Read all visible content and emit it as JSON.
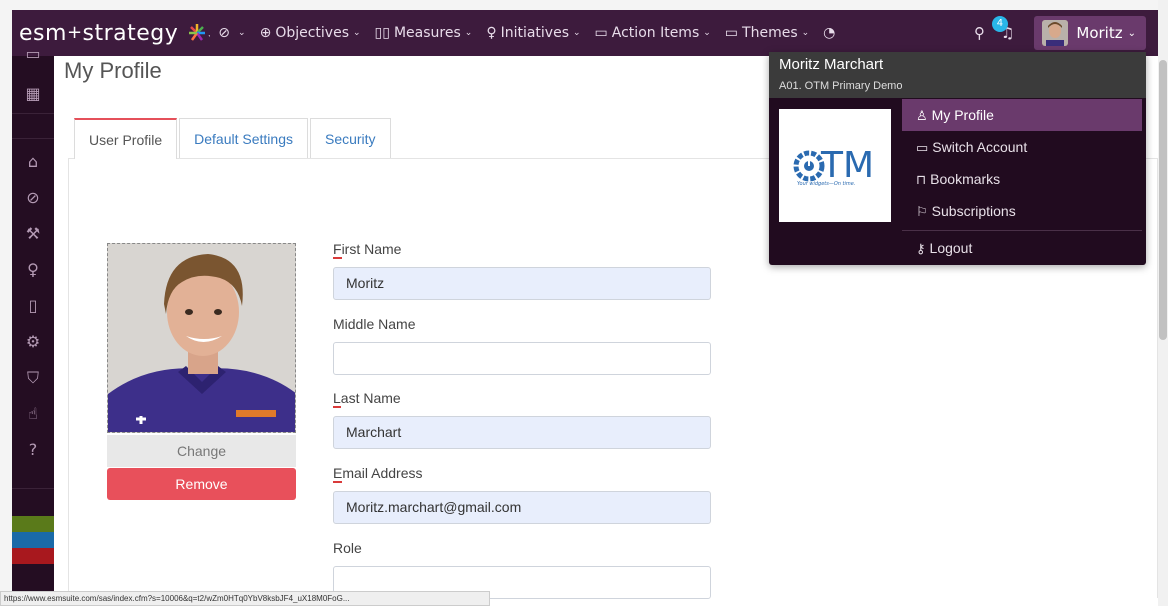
{
  "app": {
    "logo_text": "esm",
    "logo_plus": "+",
    "logo_text2": "strategy"
  },
  "nav": {
    "items": [
      {
        "icon": "compass-icon",
        "label": ""
      },
      {
        "icon": "crosshair-icon",
        "label": "Objectives"
      },
      {
        "icon": "bar-chart-icon",
        "label": "Measures"
      },
      {
        "icon": "lightbulb-icon",
        "label": "Initiatives"
      },
      {
        "icon": "inbox-icon",
        "label": "Action Items"
      },
      {
        "icon": "folder-icon",
        "label": "Themes"
      }
    ],
    "notification_count": "4",
    "user_label": "Moritz"
  },
  "page": {
    "title": "My Profile",
    "tabs": [
      {
        "label": "User Profile",
        "active": true
      },
      {
        "label": "Default Settings",
        "active": false
      },
      {
        "label": "Security",
        "active": false
      }
    ]
  },
  "photo": {
    "change_label": "Change",
    "remove_label": "Remove"
  },
  "form": {
    "first_name_label_first": "F",
    "first_name_label_rest": "irst Name",
    "first_name_value": "Moritz",
    "middle_name_label": "Middle Name",
    "middle_name_value": "",
    "last_name_label_first": "L",
    "last_name_label_rest": "ast Name",
    "last_name_value": "Marchart",
    "email_label_first": "E",
    "email_label_rest": "mail Address",
    "email_value": "Moritz.marchart@gmail.com",
    "role_label": "Role",
    "role_value": ""
  },
  "dropdown": {
    "user_name": "Moritz Marchart",
    "account": "A01. OTM Primary Demo",
    "logo_text": "TM",
    "logo_tagline": "Your widgets—On time.",
    "items": [
      {
        "icon": "user-icon",
        "label": "My Profile",
        "active": true
      },
      {
        "icon": "monitor-icon",
        "label": "Switch Account",
        "active": false
      },
      {
        "icon": "bookmark-icon",
        "label": "Bookmarks",
        "active": false
      },
      {
        "icon": "flag-icon",
        "label": "Subscriptions",
        "active": false
      },
      {
        "icon": "key-icon",
        "label": "Logout",
        "active": false
      }
    ]
  },
  "status_bar": {
    "url": "https://www.esmsuite.com/sas/index.cfm?s=10006&q=t2/wZm0HTq0YbV8ksbJF4_uX18M0FoG..."
  },
  "colors": {
    "navbar": "#3d1b3d",
    "sidebar": "#240d22",
    "accent": "#6a3a6c",
    "remove": "#e8505b",
    "input_filled": "#e8eefc"
  }
}
